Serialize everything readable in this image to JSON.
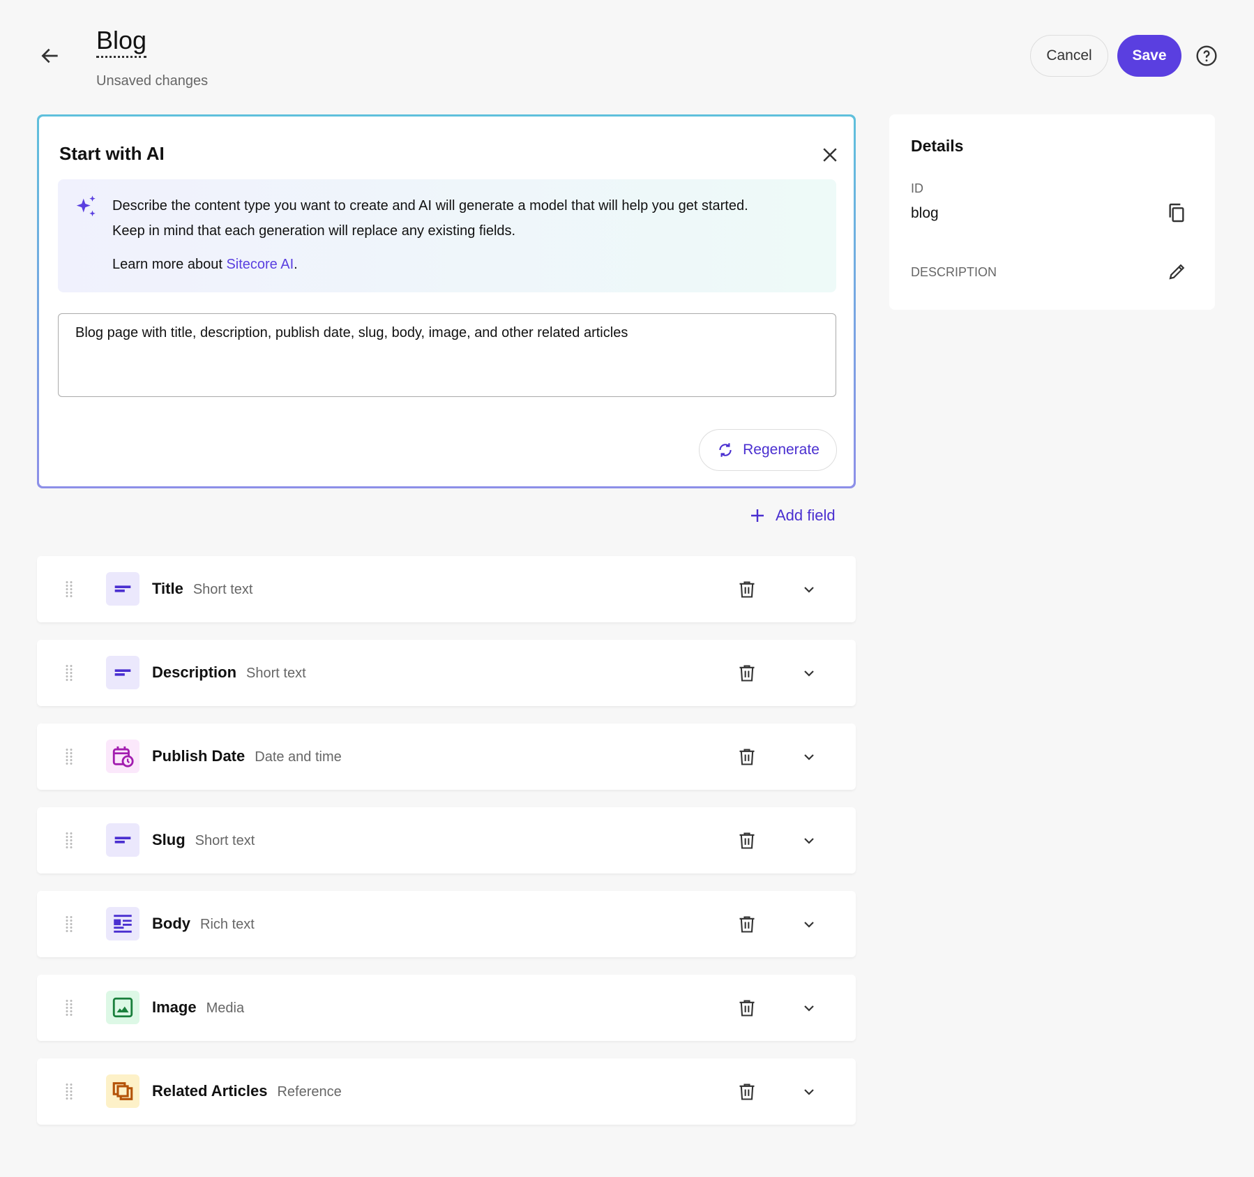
{
  "header": {
    "title": "Blog",
    "status": "Unsaved changes",
    "cancel_label": "Cancel",
    "save_label": "Save"
  },
  "ai_panel": {
    "title": "Start with AI",
    "info_line1": "Describe the content type you want to create and AI will generate a model that will help you get started.",
    "info_line2": "Keep in mind that each generation will replace any existing fields.",
    "learn_prefix": "Learn more about ",
    "learn_link": "Sitecore AI",
    "learn_suffix": ".",
    "prompt_value": "Blog page with title, description, publish date, slug, body, image, and other related articles",
    "regenerate_label": "Regenerate"
  },
  "add_field_label": "Add field",
  "fields": [
    {
      "name": "Title",
      "type": "Short text",
      "icon": "short-text-icon",
      "color": "#4a2fd0",
      "bg": "#ebe8fc"
    },
    {
      "name": "Description",
      "type": "Short text",
      "icon": "short-text-icon",
      "color": "#4a2fd0",
      "bg": "#ebe8fc"
    },
    {
      "name": "Publish Date",
      "type": "Date and time",
      "icon": "calendar-clock-icon",
      "color": "#a21caf",
      "bg": "#fbe8fb"
    },
    {
      "name": "Slug",
      "type": "Short text",
      "icon": "short-text-icon",
      "color": "#4a2fd0",
      "bg": "#ebe8fc"
    },
    {
      "name": "Body",
      "type": "Rich text",
      "icon": "rich-text-icon",
      "color": "#4a2fd0",
      "bg": "#ebe8fc"
    },
    {
      "name": "Image",
      "type": "Media",
      "icon": "image-icon",
      "color": "#1a7f3c",
      "bg": "#ddf8e6"
    },
    {
      "name": "Related Articles",
      "type": "Reference",
      "icon": "reference-icon",
      "color": "#b45309",
      "bg": "#fdf1c8"
    }
  ],
  "details": {
    "title": "Details",
    "id_label": "ID",
    "id_value": "blog",
    "description_label": "DESCRIPTION"
  },
  "colors": {
    "accent": "#5a3fe0",
    "link": "#4a2fd0"
  }
}
